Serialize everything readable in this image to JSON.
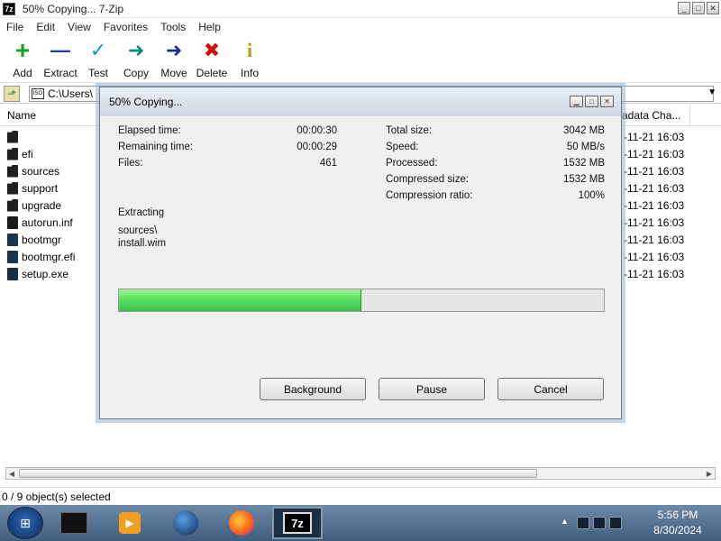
{
  "window": {
    "title": "50% Copying... 7-Zip",
    "app_icon_text": "7z",
    "controls": {
      "minimize": "_",
      "maximize": "□",
      "close": "✕"
    }
  },
  "menu": [
    "File",
    "Edit",
    "View",
    "Favorites",
    "Tools",
    "Help"
  ],
  "toolbar": [
    {
      "label": "Add",
      "icon": "plus-icon",
      "glyph": "+",
      "color": "#1aa11a"
    },
    {
      "label": "Extract",
      "icon": "minus-icon",
      "glyph": "—",
      "color": "#1a3fa8"
    },
    {
      "label": "Test",
      "icon": "check-icon",
      "glyph": "✓",
      "color": "#13a0b3"
    },
    {
      "label": "Copy",
      "icon": "copy-arrow-icon",
      "glyph": "➜",
      "color": "#0c8a7a"
    },
    {
      "label": "Move",
      "icon": "move-arrow-icon",
      "glyph": "➜",
      "color": "#1a2f8c"
    },
    {
      "label": "Delete",
      "icon": "delete-x-icon",
      "glyph": "✖",
      "color": "#d01010"
    },
    {
      "label": "Info",
      "icon": "info-icon",
      "glyph": "i",
      "color": "#b8a000"
    }
  ],
  "address": {
    "path": "C:\\Users\\",
    "iso_label": "ISO"
  },
  "filelist": {
    "columns": {
      "name": "Name",
      "metadata": "adata Cha..."
    },
    "files": [
      {
        "name": "",
        "type": "folder",
        "date": "-11-21 16:03"
      },
      {
        "name": "efi",
        "type": "folder",
        "date": "-11-21 16:03"
      },
      {
        "name": "sources",
        "type": "folder",
        "date": "-11-21 16:03"
      },
      {
        "name": "support",
        "type": "folder",
        "date": "-11-21 16:03"
      },
      {
        "name": "upgrade",
        "type": "folder",
        "date": "-11-21 16:03"
      },
      {
        "name": "autorun.inf",
        "type": "file",
        "date": "-11-21 16:03"
      },
      {
        "name": "bootmgr",
        "type": "file",
        "date": "-11-21 16:03"
      },
      {
        "name": "bootmgr.efi",
        "type": "file",
        "date": "-11-21 16:03"
      },
      {
        "name": "setup.exe",
        "type": "exe",
        "date": "-11-21 16:03"
      }
    ]
  },
  "status": {
    "selection": "0 / 9 object(s) selected"
  },
  "dialog": {
    "title": "50% Copying...",
    "elapsed_label": "Elapsed time:",
    "elapsed_value": "00:00:30",
    "remaining_label": "Remaining time:",
    "remaining_value": "00:00:29",
    "files_label": "Files:",
    "files_value": "461",
    "total_size_label": "Total size:",
    "total_size_value": "3042 MB",
    "speed_label": "Speed:",
    "speed_value": "50 MB/s",
    "processed_label": "Processed:",
    "processed_value": "1532 MB",
    "compressed_label": "Compressed size:",
    "compressed_value": "1532 MB",
    "ratio_label": "Compression ratio:",
    "ratio_value": "100%",
    "operation": "Extracting",
    "current_dir": "sources\\",
    "current_file": "install.wim",
    "progress_percent": 50,
    "buttons": {
      "background": "Background",
      "pause": "Pause",
      "cancel": "Cancel"
    }
  },
  "taskbar": {
    "time": "5:56 PM",
    "date": "8/30/2024",
    "active_app_label": "7z"
  }
}
